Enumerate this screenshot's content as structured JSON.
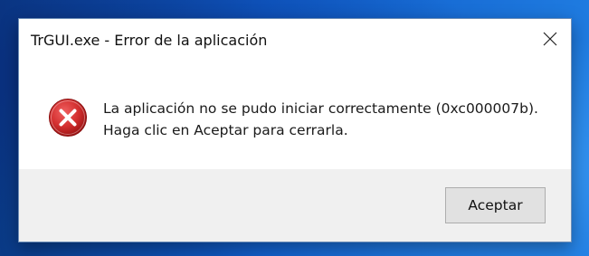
{
  "dialog": {
    "title": "TrGUI.exe - Error de la aplicación",
    "close_icon": "close-icon",
    "icon": "error-icon",
    "message_line1": "La aplicación no se pudo iniciar correctamente (0xc000007b).",
    "message_line2": "Haga clic en Aceptar para cerrarla.",
    "ok_label": "Aceptar"
  },
  "colors": {
    "desktop_background": "#0f5bc8",
    "dialog_background": "#ffffff",
    "footer_background": "#f0f0f0",
    "error_icon_red": "#d32f2f"
  }
}
